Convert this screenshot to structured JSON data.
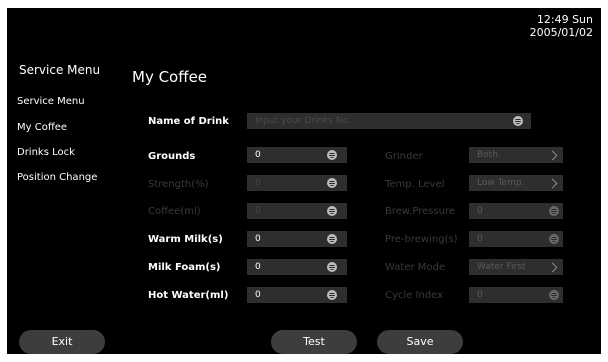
{
  "clock": {
    "time": "12:49 Sun",
    "date": "2005/01/02"
  },
  "sidebar": {
    "title": "Service Menu",
    "items": [
      {
        "label": "Service Menu"
      },
      {
        "label": "My Coffee"
      },
      {
        "label": "Drinks Lock"
      },
      {
        "label": "Position Change"
      }
    ]
  },
  "page": {
    "title": "My Coffee"
  },
  "name_of_drink": {
    "label": "Name of Drink",
    "placeholder": "Input your Drinks No."
  },
  "left_fields": [
    {
      "label": "Grounds",
      "value": "0",
      "enabled": true
    },
    {
      "label": "Strength(%)",
      "value": "0",
      "enabled": false
    },
    {
      "label": "Coffee(ml)",
      "value": "0",
      "enabled": false
    },
    {
      "label": "Warm Milk(s)",
      "value": "0",
      "enabled": true
    },
    {
      "label": "Milk Foam(s)",
      "value": "0",
      "enabled": true
    },
    {
      "label": "Hot Water(ml)",
      "value": "0",
      "enabled": true
    }
  ],
  "right_fields": [
    {
      "label": "Grinder",
      "value": "Both",
      "control": "chevron"
    },
    {
      "label": "Temp. Level",
      "value": "Low Temp.",
      "control": "chevron"
    },
    {
      "label": "Brew.Pressure",
      "value": "0",
      "control": "dial"
    },
    {
      "label": "Pre-brewing(s)",
      "value": "0",
      "control": "dial"
    },
    {
      "label": "Water Mode",
      "value": "Water First",
      "control": "chevron"
    },
    {
      "label": "Cycle Index",
      "value": "0",
      "control": "dial"
    }
  ],
  "buttons": {
    "exit": "Exit",
    "test": "Test",
    "save": "Save"
  },
  "colors": {
    "background": "#000000",
    "field": "#2e2e2e",
    "button": "#3d3d3d"
  }
}
